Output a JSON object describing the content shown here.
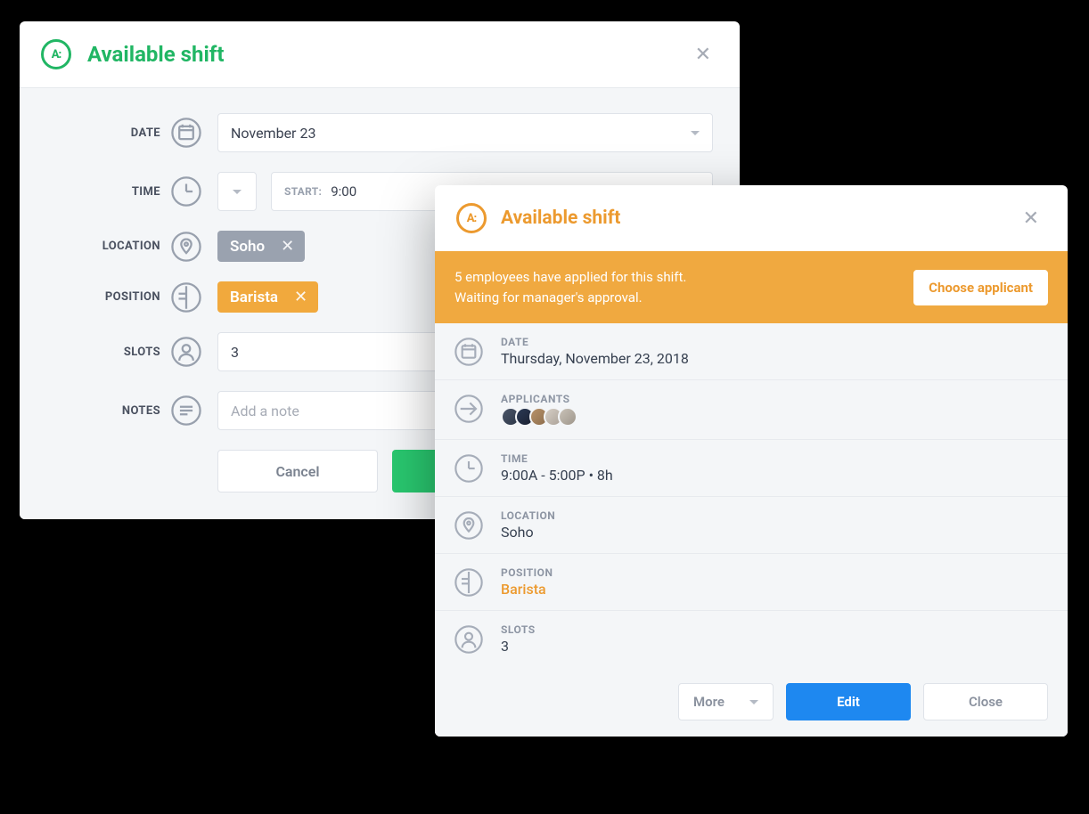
{
  "modal1": {
    "title": "Available shift",
    "labels": {
      "date": "DATE",
      "time": "TIME",
      "location": "LOCATION",
      "position": "POSITION",
      "slots": "SLOTS",
      "notes": "NOTES"
    },
    "date_value": "November 23",
    "time_start_label": "START:",
    "time_start_value": "9:00",
    "location_chip": "Soho",
    "position_chip": "Barista",
    "slots_value": "3",
    "notes_placeholder": "Add a note",
    "cancel": "Cancel"
  },
  "modal2": {
    "title": "Available shift",
    "banner_line1": "5 employees have applied for this shift.",
    "banner_line2": "Waiting for manager's approval.",
    "choose_applicant": "Choose applicant",
    "rows": {
      "date_label": "DATE",
      "date_value": "Thursday, November 23, 2018",
      "applicants_label": "APPLICANTS",
      "time_label": "TIME",
      "time_value": "9:00A - 5:00P • 8h",
      "location_label": "LOCATION",
      "location_value": "Soho",
      "position_label": "POSITION",
      "position_value": "Barista",
      "slots_label": "SLOTS",
      "slots_value": "3"
    },
    "footer": {
      "more": "More",
      "edit": "Edit",
      "close": "Close"
    }
  }
}
